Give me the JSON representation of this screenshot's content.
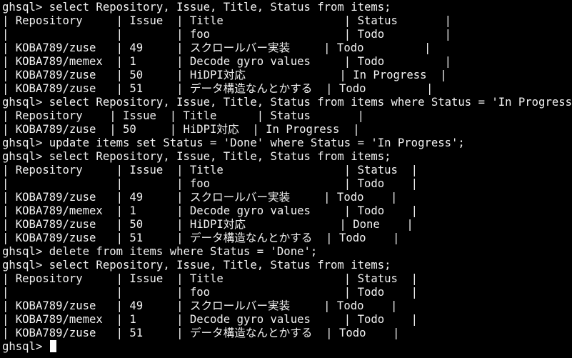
{
  "terminal": {
    "lines": [
      "ghsql> select Repository, Issue, Title, Status from items;",
      "| Repository     | Issue  | Title                  | Status       |",
      "|                |        | foo                    | Todo         |",
      "| KOBA789/zuse   | 49     | スクロールバー実装     | Todo         |",
      "| KOBA789/memex  | 1      | Decode gyro values     | Todo         |",
      "| KOBA789/zuse   | 50     | HiDPI対応              | In Progress  |",
      "| KOBA789/zuse   | 51     | データ構造なんとかする  | Todo         |",
      "ghsql> select Repository, Issue, Title, Status from items where Status = 'In Progress';",
      "| Repository    | Issue  | Title      | Status       |",
      "| KOBA789/zuse  | 50     | HiDPI対応  | In Progress  |",
      "ghsql> update items set Status = 'Done' where Status = 'In Progress';",
      "ghsql> select Repository, Issue, Title, Status from items;",
      "| Repository     | Issue  | Title                  | Status  |",
      "|                |        | foo                    | Todo    |",
      "| KOBA789/zuse   | 49     | スクロールバー実装     | Todo    |",
      "| KOBA789/memex  | 1      | Decode gyro values     | Todo    |",
      "| KOBA789/zuse   | 50     | HiDPI対応              | Done    |",
      "| KOBA789/zuse   | 51     | データ構造なんとかする  | Todo    |",
      "ghsql> delete from items where Status = 'Done';",
      "ghsql> select Repository, Issue, Title, Status from items;",
      "| Repository     | Issue  | Title                  | Status  |",
      "|                |        | foo                    | Todo    |",
      "| KOBA789/zuse   | 49     | スクロールバー実装     | Todo    |",
      "| KOBA789/memex  | 1      | Decode gyro values     | Todo    |",
      "| KOBA789/zuse   | 51     | データ構造なんとかする  | Todo    |"
    ],
    "prompt": "ghsql> "
  },
  "colors": {
    "background": "#000000",
    "foreground": "#f2f2f2",
    "cursor": "#ffffff"
  }
}
